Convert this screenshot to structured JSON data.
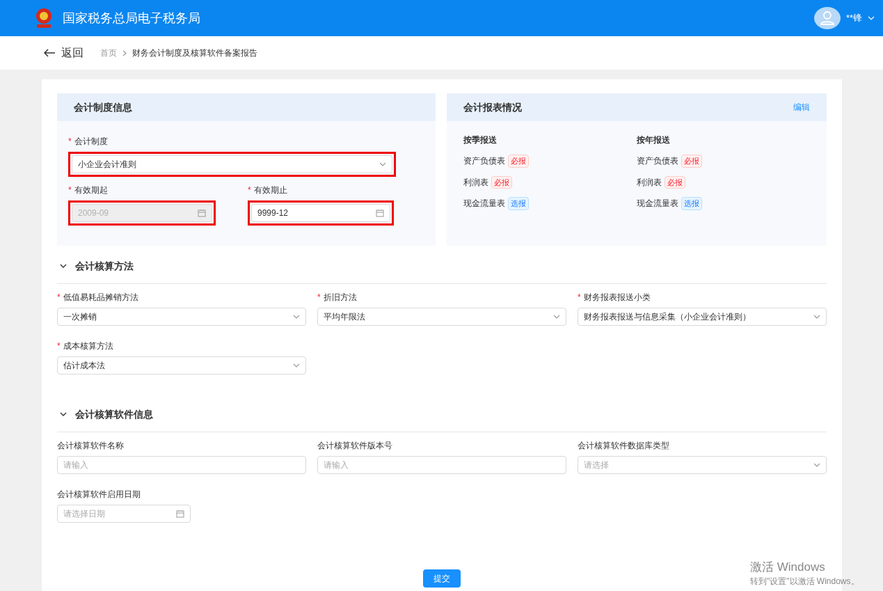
{
  "header": {
    "title": "国家税务总局电子税务局",
    "user": "**锋"
  },
  "breadcrumb": {
    "back": "返回",
    "items": [
      {
        "label": "首页",
        "current": false
      },
      {
        "label": "财务会计制度及核算软件备案报告",
        "current": true
      }
    ]
  },
  "system_panel": {
    "title": "会计制度信息",
    "fields": [
      {
        "kind": "select",
        "label": "会计制度",
        "required": true,
        "value": "小企业会计准则",
        "disabled": false,
        "highlighted": true
      },
      {
        "kind": "date",
        "label": "有效期起",
        "required": true,
        "value": "2009-09",
        "disabled": true,
        "highlighted": true
      },
      {
        "kind": "date",
        "label": "有效期止",
        "required": true,
        "value": "9999-12",
        "disabled": false,
        "highlighted": true
      }
    ]
  },
  "report_panel": {
    "title": "会计报表情况",
    "action": "编辑",
    "columns": [
      {
        "title": "按季报送",
        "rows": [
          {
            "name": "资产负债表",
            "tag": "必报",
            "kind": "required"
          },
          {
            "name": "利润表",
            "tag": "必报",
            "kind": "required"
          },
          {
            "name": "现金流量表",
            "tag": "选报",
            "kind": "optional"
          }
        ]
      },
      {
        "title": "按年报送",
        "rows": [
          {
            "name": "资产负债表",
            "tag": "必报",
            "kind": "required"
          },
          {
            "name": "利润表",
            "tag": "必报",
            "kind": "required"
          },
          {
            "name": "现金流量表",
            "tag": "选报",
            "kind": "optional"
          }
        ]
      }
    ]
  },
  "sections": [
    {
      "title": "会计核算方法",
      "expanded": true,
      "fields": [
        {
          "kind": "select",
          "label": "低值易耗品摊销方法",
          "required": true,
          "value": "一次摊销"
        },
        {
          "kind": "select",
          "label": "折旧方法",
          "required": true,
          "value": "平均年限法"
        },
        {
          "kind": "select",
          "label": "财务报表报送小类",
          "required": true,
          "value": "财务报表报送与信息采集（小企业会计准则）"
        },
        {
          "kind": "select",
          "label": "成本核算方法",
          "required": true,
          "value": "估计成本法"
        }
      ]
    },
    {
      "title": "会计核算软件信息",
      "expanded": true,
      "fields": [
        {
          "kind": "text",
          "label": "会计核算软件名称",
          "required": false,
          "placeholder": "请输入"
        },
        {
          "kind": "text",
          "label": "会计核算软件版本号",
          "required": false,
          "placeholder": "请输入"
        },
        {
          "kind": "select",
          "label": "会计核算软件数据库类型",
          "required": false,
          "placeholder": "请选择"
        },
        {
          "kind": "date",
          "label": "会计核算软件启用日期",
          "required": false,
          "placeholder": "请选择日期"
        }
      ]
    }
  ],
  "required_mark": "*",
  "submit": "提交",
  "os_notice": {
    "title": "激活 Windows",
    "subtitle": "转到\"设置\"以激活 Windows。"
  }
}
